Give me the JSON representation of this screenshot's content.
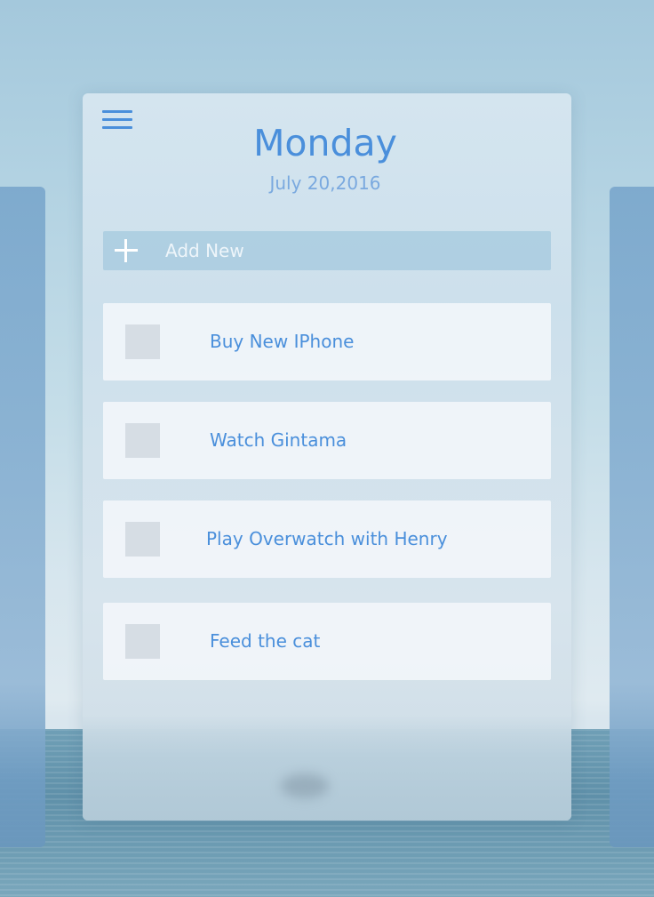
{
  "header": {
    "day": "Monday",
    "date": "July 20,2016"
  },
  "add_new": {
    "label": "Add New"
  },
  "tasks": [
    {
      "label": "Buy New IPhone",
      "checked": false
    },
    {
      "label": "Watch Gintama",
      "checked": false
    },
    {
      "label": "Play Overwatch with Henry",
      "checked": false
    },
    {
      "label": "Feed the cat",
      "checked": false
    }
  ],
  "icons": {
    "menu": "hamburger-menu-icon",
    "add": "plus-icon"
  },
  "colors": {
    "accent": "#4a8fdb",
    "date_text": "#7aa9df",
    "checkbox": "#d6dde4",
    "add_bar": "#96c1d8"
  }
}
